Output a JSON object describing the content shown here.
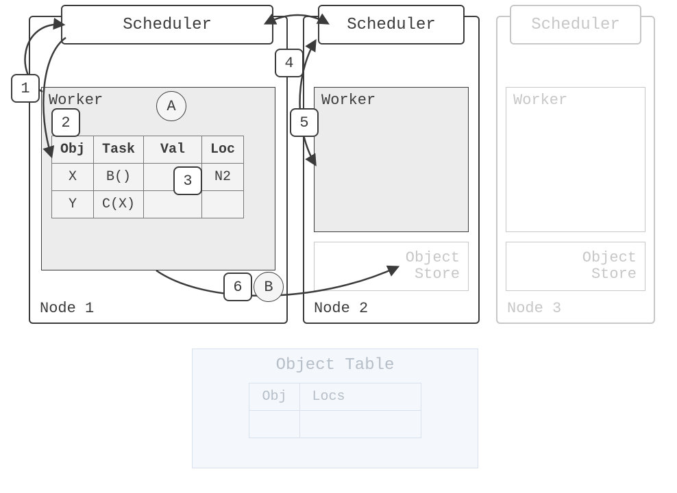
{
  "labels": {
    "scheduler": "Scheduler",
    "worker": "Worker",
    "objectStore": "Object\nStore",
    "objectTable": "Object Table"
  },
  "nodes": [
    {
      "id": "n1",
      "label": "Node 1",
      "faded": false
    },
    {
      "id": "n2",
      "label": "Node 2",
      "faded": false
    },
    {
      "id": "n3",
      "label": "Node 3",
      "faded": true
    }
  ],
  "markers": {
    "numbers": [
      "1",
      "2",
      "3",
      "4",
      "5",
      "6"
    ],
    "letters": [
      "A",
      "B"
    ]
  },
  "workerTable": {
    "headers": [
      "Obj",
      "Task",
      "Val",
      "Loc"
    ],
    "rows": [
      {
        "obj": "X",
        "task": "B()",
        "val": "",
        "loc": "N2",
        "locBold": true
      },
      {
        "obj": "Y",
        "task": "C(X)",
        "val": "",
        "loc": ""
      }
    ]
  },
  "bottomTable": {
    "headers": [
      "Obj",
      "Locs"
    ],
    "rows": [
      {
        "obj": "",
        "locs": ""
      }
    ]
  }
}
